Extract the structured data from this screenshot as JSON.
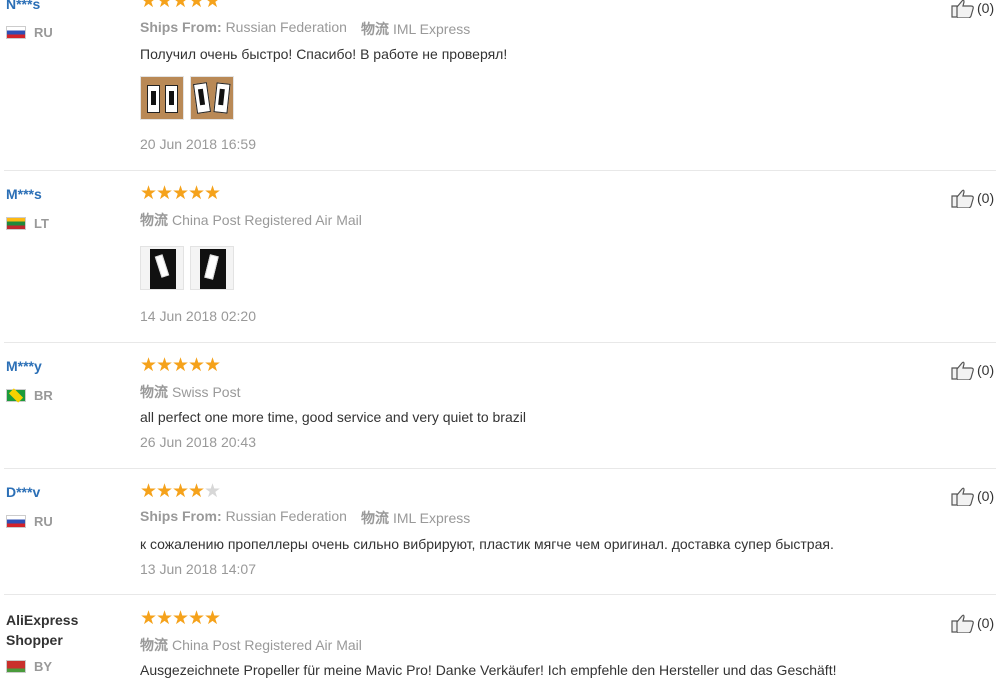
{
  "reviews": [
    {
      "name": "N***s",
      "country": "RU",
      "rating": 5,
      "ships_from_label": "Ships From:",
      "ships_from": "Russian Federation",
      "logistics_label": "物流",
      "logistics": "IML Express",
      "feedback": "Получил очень быстро! Спасибо! В работе не проверял!",
      "date": "20 Jun 2018 16:59",
      "helpful": "(0)"
    },
    {
      "name": "M***s",
      "country": "LT",
      "rating": 5,
      "logistics_label": "物流",
      "logistics": "China Post Registered Air Mail",
      "feedback": "",
      "date": "14 Jun 2018 02:20",
      "helpful": "(0)"
    },
    {
      "name": "M***y",
      "country": "BR",
      "rating": 5,
      "logistics_label": "物流",
      "logistics": "Swiss Post",
      "feedback": "all perfect one more time, good service and very quiet to brazil",
      "date": "26 Jun 2018 20:43",
      "helpful": "(0)"
    },
    {
      "name": "D***v",
      "country": "RU",
      "rating": 4,
      "ships_from_label": "Ships From:",
      "ships_from": "Russian Federation",
      "logistics_label": "物流",
      "logistics": "IML Express",
      "feedback": "к сожалению пропеллеры очень сильно вибрируют, пластик мягче чем оригинал. доставка супер быстрая.",
      "date": "13 Jun 2018 14:07",
      "helpful": "(0)"
    },
    {
      "name": "AliExpress Shopper",
      "country": "BY",
      "rating": 5,
      "logistics_label": "物流",
      "logistics": "China Post Registered Air Mail",
      "feedback": "Ausgezeichnete Propeller für meine Mavic Pro! Danke Verkäufer! Ich empfehle den Hersteller und das Geschäft!",
      "helpful": "(0)"
    }
  ],
  "colors": {
    "star": "#f5a21b",
    "name": "#2b6fb6",
    "muted": "#999999"
  },
  "icons": {
    "rating": "star-icon",
    "helpful": "thumbs-up-icon"
  }
}
